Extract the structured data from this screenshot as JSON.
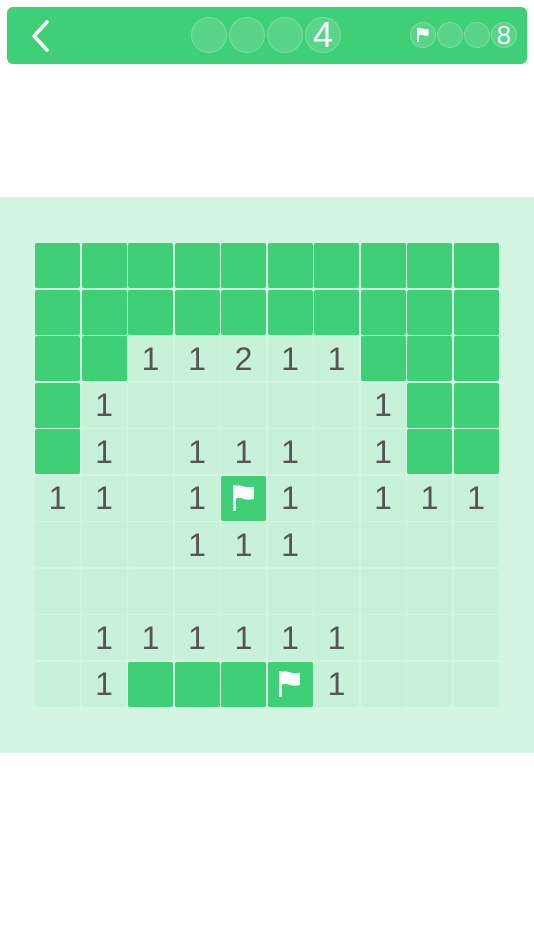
{
  "header": {
    "back_icon": "chevron-left-icon",
    "level_number": "4",
    "flags_remaining": "8",
    "flag_icon": "flag-icon"
  },
  "colors": {
    "accent": "#3ecf77",
    "board_background": "#d5f5e3",
    "revealed_cell": "#c7f1d8",
    "number_text": "#555555"
  },
  "board": {
    "rows": [
      [
        "H",
        "H",
        "H",
        "H",
        "H",
        "H",
        "H",
        "H",
        "H",
        "H"
      ],
      [
        "H",
        "H",
        "H",
        "H",
        "H",
        "H",
        "H",
        "H",
        "H",
        "H"
      ],
      [
        "H",
        "H",
        "1",
        "1",
        "2",
        "1",
        "1",
        "H",
        "H",
        "H"
      ],
      [
        "H",
        "1",
        "",
        "",
        "",
        "",
        "",
        "1",
        "H",
        "H"
      ],
      [
        "H",
        "1",
        "",
        "1",
        "1",
        "1",
        "",
        "1",
        "H",
        "H"
      ],
      [
        "1",
        "1",
        "",
        "1",
        "F",
        "1",
        "",
        "1",
        "1",
        "1"
      ],
      [
        "",
        "",
        "",
        "1",
        "1",
        "1",
        "",
        "",
        "",
        ""
      ],
      [
        "",
        "",
        "",
        "",
        "",
        "",
        "",
        "",
        "",
        ""
      ],
      [
        "",
        "1",
        "1",
        "1",
        "1",
        "1",
        "1",
        "",
        "",
        ""
      ],
      [
        "",
        "1",
        "H",
        "H",
        "H",
        "F",
        "1",
        "",
        "",
        ""
      ]
    ]
  }
}
